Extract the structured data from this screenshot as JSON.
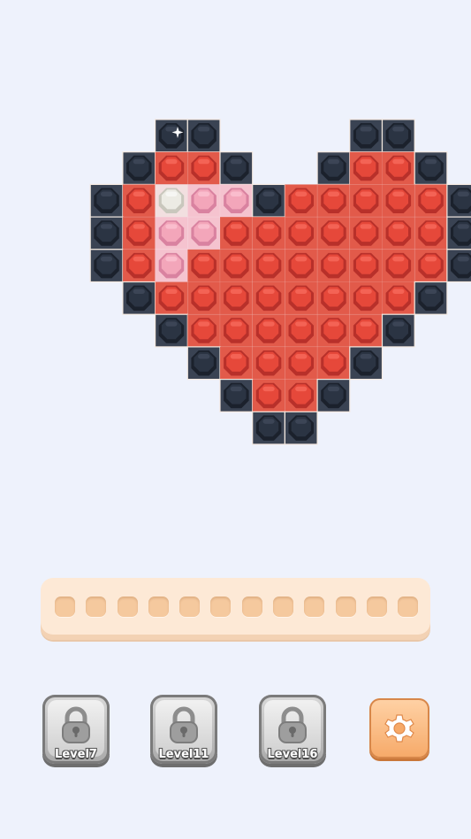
{
  "board": {
    "cell_colors": {
      "D": "#2b3443",
      "R": "#e6483a",
      "P": "#f3a6ba",
      "W": "#ecebe4"
    },
    "pattern": [
      "...DD....DD...",
      "..DRRD..DRRD..",
      ".DRWPPDRRRRRD.",
      ".DRPPRRRRRRRD.",
      ".DRPRRRRRRRRD.",
      "..DRRRRRRRRD..",
      "...DRRRRRRD...",
      "....DRRRRD....",
      ".....DRRD.....",
      "......DD......"
    ]
  },
  "tray": {
    "slot_count": 12
  },
  "toolbar": {
    "locked_items": [
      {
        "label": "Level7"
      },
      {
        "label": "Level11"
      },
      {
        "label": "Level16"
      }
    ],
    "settings_icon": "gear-icon"
  },
  "colors": {
    "background": "#eef2fc",
    "tray": "#fde9d6",
    "settings_button": "#f9b77a"
  }
}
